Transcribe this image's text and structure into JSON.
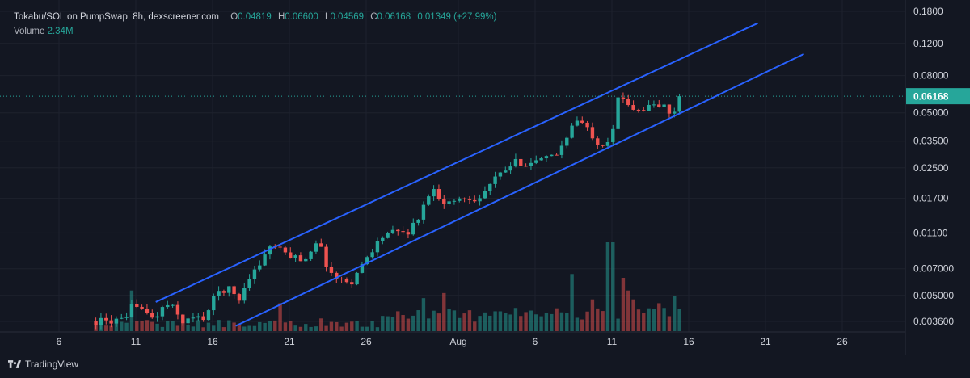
{
  "header": {
    "symbol": "Tokabu/SOL on PumpSwap, 8h, dexscreener.com",
    "open_label": "O",
    "open": "0.04819",
    "high_label": "H",
    "high": "0.06600",
    "low_label": "L",
    "low": "0.04569",
    "close_label": "C",
    "close": "0.06168",
    "change": "0.01349 (+27.99%)",
    "volume_label": "Volume",
    "volume": "2.34M"
  },
  "branding": {
    "name": "TradingView"
  },
  "colors": {
    "up": "#26a69a",
    "down": "#ef5350",
    "channel": "#2962ff",
    "background": "#131722",
    "grid": "#1e222d",
    "price_badge": "#26a69a"
  },
  "chart_data": {
    "type": "candlestick",
    "title": "Tokabu/SOL on PumpSwap, 8h, dexscreener.com",
    "timeframe": "8h",
    "y_scale": "log",
    "ylim": [
      0.0033,
      0.19
    ],
    "y_ticks": [
      "0.1800",
      "0.1200",
      "0.08000",
      "0.05000",
      "0.03500",
      "0.02500",
      "0.01700",
      "0.01100",
      "0.007000",
      "0.005000",
      "0.003600"
    ],
    "x_ticks": [
      {
        "label": "6",
        "day": 6
      },
      {
        "label": "11",
        "day": 11
      },
      {
        "label": "16",
        "day": 16
      },
      {
        "label": "21",
        "day": 21
      },
      {
        "label": "26",
        "day": 26
      },
      {
        "label": "Aug",
        "day": 32
      },
      {
        "label": "6",
        "day": 37
      },
      {
        "label": "11",
        "day": 42
      },
      {
        "label": "16",
        "day": 47
      },
      {
        "label": "21",
        "day": 52
      },
      {
        "label": "26",
        "day": 57
      }
    ],
    "last_price": "0.06168",
    "anchors": [
      [
        10.6,
        0.0042
      ],
      [
        11.0,
        0.0046
      ],
      [
        11.5,
        0.0041
      ],
      [
        12.0,
        0.0037
      ],
      [
        12.5,
        0.004
      ],
      [
        13.0,
        0.0045
      ],
      [
        13.5,
        0.0042
      ],
      [
        14.0,
        0.0036
      ],
      [
        14.5,
        0.0037
      ],
      [
        15.5,
        0.0038
      ],
      [
        16.3,
        0.0052
      ],
      [
        17.0,
        0.0055
      ],
      [
        17.7,
        0.0047
      ],
      [
        18.4,
        0.0064
      ],
      [
        19.0,
        0.0072
      ],
      [
        19.5,
        0.0088
      ],
      [
        20.0,
        0.0094
      ],
      [
        20.6,
        0.0085
      ],
      [
        21.2,
        0.0082
      ],
      [
        22.0,
        0.0078
      ],
      [
        22.8,
        0.0102
      ],
      [
        23.6,
        0.0067
      ],
      [
        24.3,
        0.006
      ],
      [
        25.1,
        0.006
      ],
      [
        25.6,
        0.007
      ],
      [
        26.0,
        0.008
      ],
      [
        26.6,
        0.0095
      ],
      [
        27.3,
        0.011
      ],
      [
        28.1,
        0.011
      ],
      [
        28.8,
        0.0112
      ],
      [
        29.6,
        0.0142
      ],
      [
        30.2,
        0.0196
      ],
      [
        31.0,
        0.0165
      ],
      [
        31.5,
        0.016
      ],
      [
        32.0,
        0.017
      ],
      [
        32.8,
        0.017
      ],
      [
        33.5,
        0.0173
      ],
      [
        34.2,
        0.021
      ],
      [
        35.0,
        0.024
      ],
      [
        35.8,
        0.027
      ],
      [
        36.5,
        0.0265
      ],
      [
        37.0,
        0.027
      ],
      [
        37.8,
        0.028
      ],
      [
        38.5,
        0.03
      ],
      [
        39.2,
        0.04
      ],
      [
        39.8,
        0.046
      ],
      [
        40.6,
        0.039
      ],
      [
        41.3,
        0.033
      ],
      [
        42.0,
        0.038
      ],
      [
        42.3,
        0.058
      ],
      [
        42.8,
        0.06
      ],
      [
        43.3,
        0.054
      ],
      [
        44.0,
        0.052
      ],
      [
        44.6,
        0.055
      ],
      [
        45.4,
        0.054
      ],
      [
        45.8,
        0.048
      ],
      [
        46.3,
        0.055
      ],
      [
        46.6,
        0.0617
      ]
    ],
    "volume_spikes": [
      [
        10.6,
        0.32
      ],
      [
        15.5,
        0.03
      ],
      [
        18.6,
        0.04
      ],
      [
        20.4,
        0.22
      ],
      [
        23.0,
        0.1
      ],
      [
        27.0,
        0.12
      ],
      [
        29.6,
        0.26
      ],
      [
        31.0,
        0.3
      ],
      [
        33.4,
        0.12
      ],
      [
        36.4,
        0.15
      ],
      [
        38.4,
        0.18
      ],
      [
        39.4,
        0.45
      ],
      [
        40.6,
        0.25
      ],
      [
        41.9,
        0.7
      ],
      [
        42.6,
        0.42
      ],
      [
        43.1,
        0.32
      ],
      [
        43.5,
        0.25
      ],
      [
        44.3,
        0.18
      ],
      [
        45.2,
        0.22
      ],
      [
        46.0,
        0.28
      ]
    ],
    "channel_upper": [
      [
        12.3,
        0.0046
      ],
      [
        51.5,
        0.155
      ]
    ],
    "channel_lower": [
      [
        17.5,
        0.0034
      ],
      [
        54.5,
        0.105
      ]
    ],
    "grid": true
  }
}
